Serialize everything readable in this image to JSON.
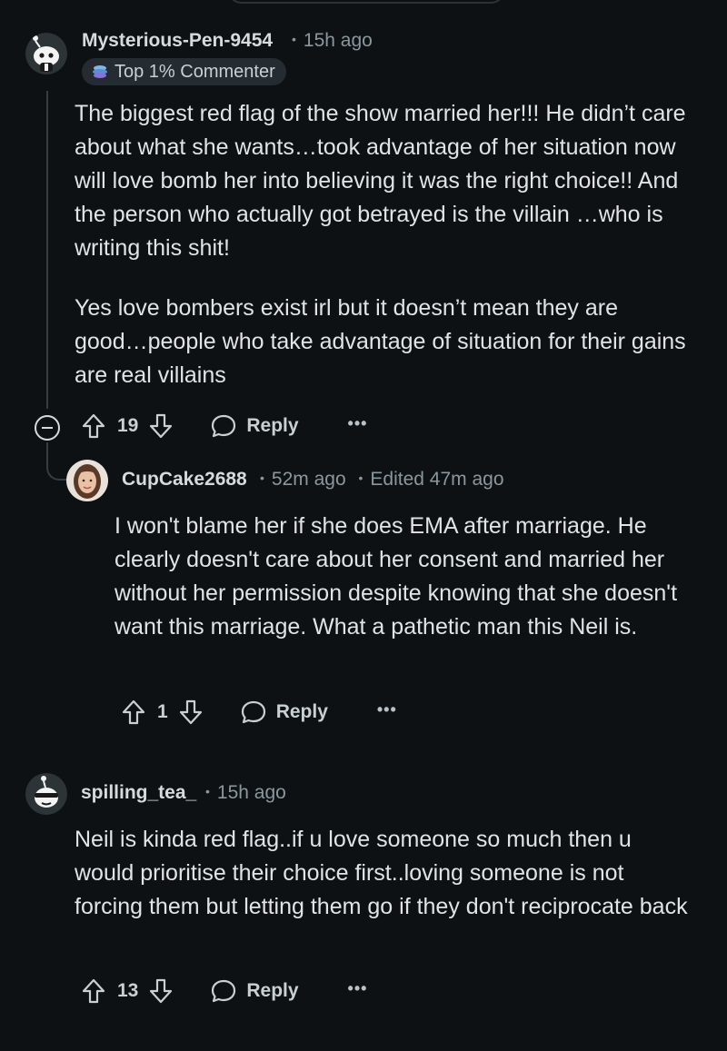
{
  "comments": [
    {
      "author": "Mysterious-Pen-9454",
      "meta": "15h ago",
      "badge": "Top 1% Commenter",
      "paragraphs": [
        "The biggest red flag of the show married her!!! He didn’t care about what she wants…took advantage of her situation now will love bomb her into believing it was the right choice!! And the person who actually got betrayed is the villain …who is writing this shit!",
        "Yes love bombers exist irl but it doesn’t mean they are good…people who take advantage of situation for their gains are real villains"
      ],
      "votes": "19",
      "reply_label": "Reply",
      "more": "•••"
    },
    {
      "author": "CupCake2688",
      "meta": "52m ago",
      "edited": "Edited 47m ago",
      "paragraphs": [
        "I won't blame her if she does EMA after marriage. He clearly doesn't care about her consent and married her without her permission despite knowing that she doesn't want this marriage. What a pathetic man this Neil is."
      ],
      "votes": "1",
      "reply_label": "Reply",
      "more": "•••"
    },
    {
      "author": "spilling_tea_",
      "meta": "15h ago",
      "paragraphs": [
        "Neil is kinda red flag..if u love someone so much then u would prioritise their choice first..loving someone is not forcing them but letting them go if they don't reciprocate back"
      ],
      "votes": "13",
      "reply_label": "Reply",
      "more": "•••"
    }
  ],
  "separator": "•",
  "icons": {
    "upvote": "upvote-icon",
    "downvote": "downvote-icon",
    "reply": "speech-bubble-icon",
    "collapse": "collapse-minus-icon",
    "badge": "top-commenter-icon"
  },
  "colors": {
    "background": "#0e1113",
    "text": "#e1e4e6",
    "meta": "#8b979e",
    "badge_bg": "#242c31"
  }
}
